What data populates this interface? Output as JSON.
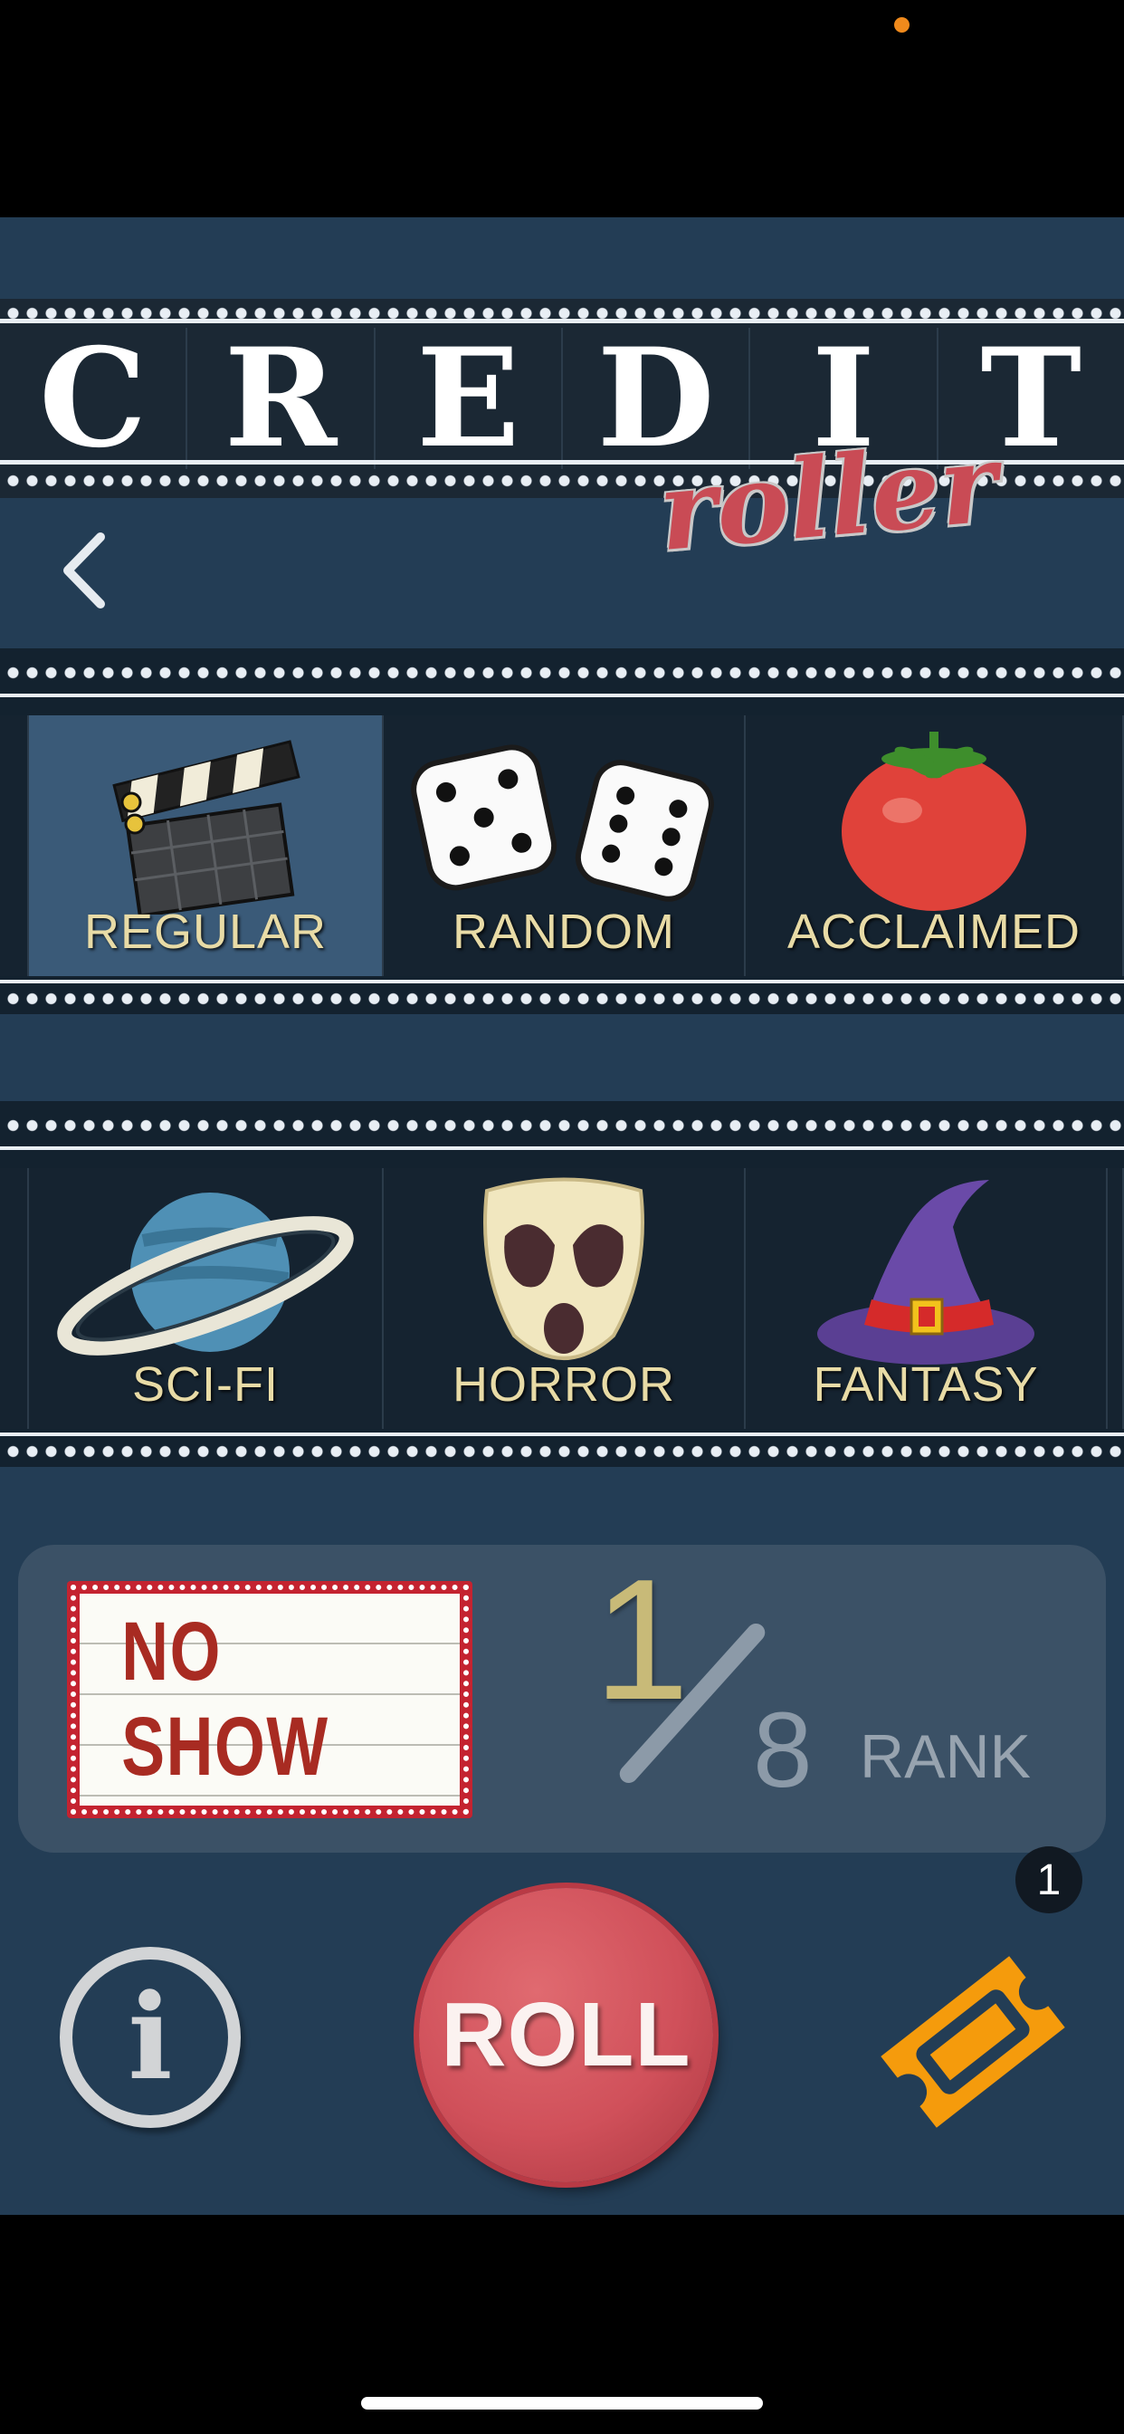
{
  "app": {
    "title_letters": [
      "C",
      "R",
      "E",
      "D",
      "I",
      "T"
    ],
    "subtitle": "roller"
  },
  "mode_strip": {
    "items": [
      {
        "label": "REGULAR",
        "icon": "clapperboard-icon",
        "selected": true
      },
      {
        "label": "RANDOM",
        "icon": "dice-icon",
        "selected": false
      },
      {
        "label": "ACCLAIMED",
        "icon": "tomato-icon",
        "selected": false
      }
    ]
  },
  "genre_strip": {
    "items": [
      {
        "label": "SCI-FI",
        "icon": "planet-icon"
      },
      {
        "label": "HORROR",
        "icon": "mask-icon"
      },
      {
        "label": "FANTASY",
        "icon": "witch-hat-icon"
      }
    ]
  },
  "status": {
    "marquee_text": "NO SHOW",
    "numerator": "1",
    "denominator": "8",
    "rank_label": "RANK"
  },
  "controls": {
    "info_glyph": "i",
    "roll_label": "ROLL",
    "ticket_count": "1"
  },
  "colors": {
    "background": "#233d55",
    "label": "#e8dba6",
    "roll": "#d0505a",
    "ticket": "#f59b0c",
    "selected_cell": "#3a5a78"
  }
}
